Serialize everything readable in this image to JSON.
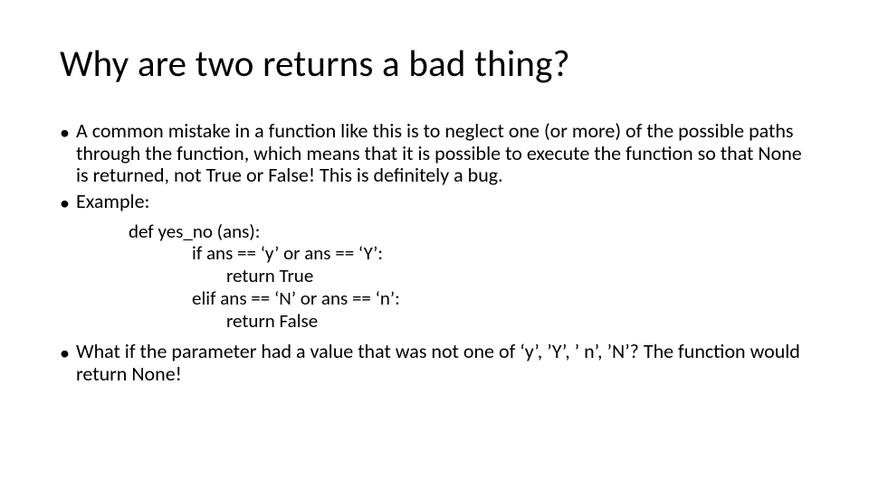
{
  "title": "Why are two returns a bad thing?",
  "bullet_marker": "•",
  "bullets": {
    "b1": "A common mistake in a function like this is to neglect one (or more) of the possible paths through the function, which means that it is possible to execute the function so that None is returned, not True or False!  This is definitely a bug.",
    "b2": "Example:",
    "b3": "What if the parameter had a value that was not one of ‘y’, ’Y’, ’ n’, ’N’?  The function would return None!"
  },
  "code": {
    "l1": "def yes_no (ans):",
    "l2": "if ans == ‘y’ or ans == ‘Y’:",
    "l3": "return True",
    "l4": "elif ans == ‘N’ or ans == ‘n’:",
    "l5": "return False"
  }
}
